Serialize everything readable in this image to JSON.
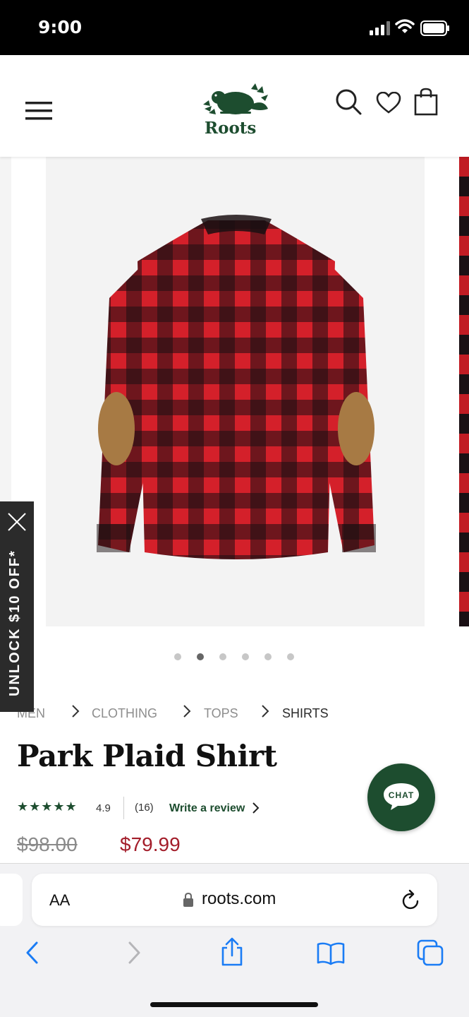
{
  "status_bar": {
    "time": "9:00"
  },
  "brand": {
    "logo_text": "Roots",
    "color": "#1d4d2f"
  },
  "header": {
    "icons": [
      "menu-icon",
      "search-icon",
      "heart-icon",
      "bag-icon"
    ]
  },
  "gallery": {
    "slide_count": 6,
    "active_index": 1
  },
  "promo": {
    "label": "UNLOCK $10 OFF*"
  },
  "breadcrumb": [
    {
      "label": "MEN"
    },
    {
      "label": "CLOTHING"
    },
    {
      "label": "TOPS"
    },
    {
      "label": "SHIRTS"
    }
  ],
  "product": {
    "title": "Park Plaid Shirt",
    "stars": "★★★★★",
    "rating": "4.9",
    "review_count": "(16)",
    "write_review": "Write a review",
    "old_price": "$98.00",
    "price": "$79.99",
    "price_color": "#a31d2a"
  },
  "chat": {
    "label": "CHAT"
  },
  "safari": {
    "aa_label": "AA",
    "url": "roots.com"
  }
}
